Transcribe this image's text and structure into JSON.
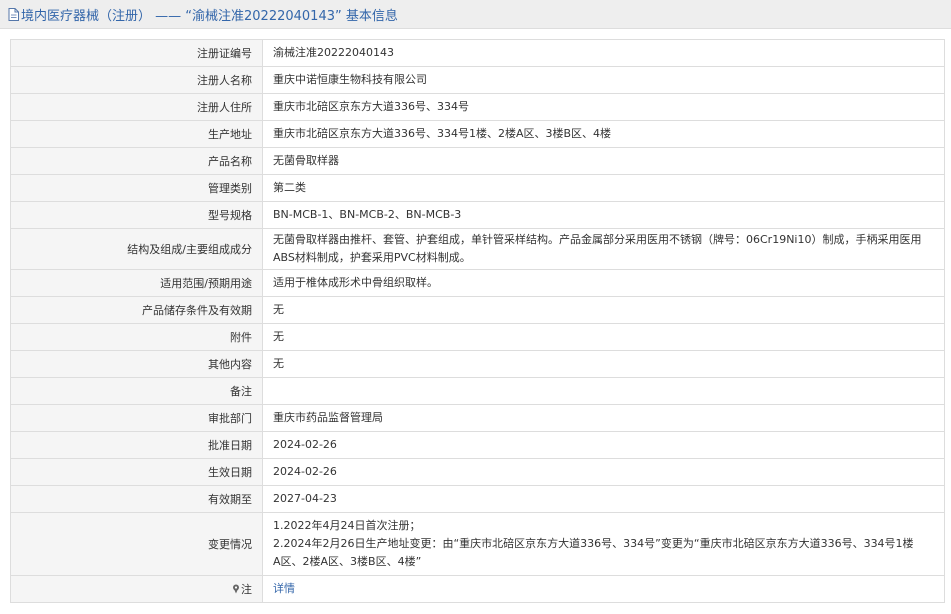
{
  "header": {
    "title": "境内医疗器械（注册） —— “渝械注准20222040143” 基本信息"
  },
  "rows": [
    {
      "label": "注册证编号",
      "value": "渝械注准20222040143"
    },
    {
      "label": "注册人名称",
      "value": "重庆中诺恒康生物科技有限公司"
    },
    {
      "label": "注册人住所",
      "value": "重庆市北碚区京东方大道336号、334号"
    },
    {
      "label": "生产地址",
      "value": "重庆市北碚区京东方大道336号、334号1楼、2楼A区、3楼B区、4楼"
    },
    {
      "label": "产品名称",
      "value": "无菌骨取样器"
    },
    {
      "label": "管理类别",
      "value": "第二类"
    },
    {
      "label": "型号规格",
      "value": "BN-MCB-1、BN-MCB-2、BN-MCB-3"
    },
    {
      "label": "结构及组成/主要组成成分",
      "value_lines": [
        "无菌骨取样器由推杆、套管、护套组成，单针管采样结构。产品金属部分采用医用不锈钢（牌号：06Cr19Ni10）制成，手柄采用医用",
        "ABS材料制成，护套采用PVC材料制成。"
      ]
    },
    {
      "label": "适用范围/预期用途",
      "value": "适用于椎体成形术中骨组织取样。"
    },
    {
      "label": "产品储存条件及有效期",
      "value": "无"
    },
    {
      "label": "附件",
      "value": "无"
    },
    {
      "label": "其他内容",
      "value": "无"
    },
    {
      "label": "备注",
      "value": ""
    },
    {
      "label": "审批部门",
      "value": "重庆市药品监督管理局"
    },
    {
      "label": "批准日期",
      "value": "2024-02-26"
    },
    {
      "label": "生效日期",
      "value": "2024-02-26"
    },
    {
      "label": "有效期至",
      "value": "2027-04-23"
    },
    {
      "label": "变更情况",
      "value_lines": [
        "1.2022年4月24日首次注册；",
        "2.2024年2月26日生产地址变更：由“重庆市北碚区京东方大道336号、334号”变更为“重庆市北碚区京东方大道336号、334号1楼",
        "A区、2楼A区、3楼B区、4楼”"
      ]
    }
  ],
  "note": {
    "label": "注",
    "link": "详情",
    "icon": "pin-icon"
  }
}
